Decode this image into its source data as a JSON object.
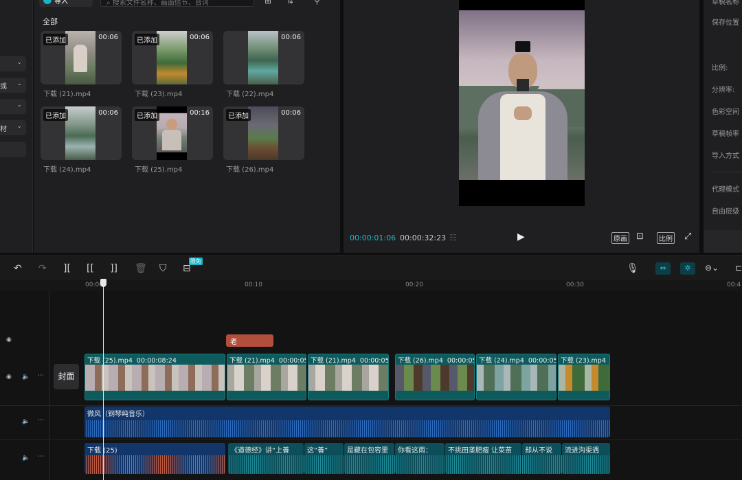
{
  "media": {
    "import_label": "导入",
    "search_placeholder": "搜索文件名称、画面信节、台词",
    "section": "全部",
    "clips": [
      {
        "name": "下载 (21).mp4",
        "duration": "00:06",
        "badge": "已添加"
      },
      {
        "name": "下载 (23).mp4",
        "duration": "00:06",
        "badge": "已添加"
      },
      {
        "name": "下载 (22).mp4",
        "duration": "00:06",
        "badge": ""
      },
      {
        "name": "下载 (24).mp4",
        "duration": "00:06",
        "badge": "已添加"
      },
      {
        "name": "下载 (25).mp4",
        "duration": "00:16",
        "badge": "已添加"
      },
      {
        "name": "下载 (26).mp4",
        "duration": "00:06",
        "badge": "已添加"
      }
    ]
  },
  "left_strip": {
    "items": [
      "",
      "或",
      "",
      "材"
    ]
  },
  "preview": {
    "current_time": "00:00:01:06",
    "total_time": "00:00:32:23",
    "original_label": "原画",
    "ratio_label": "比例"
  },
  "props": {
    "labels": [
      "草稿名称",
      "保存位置",
      "比例:",
      "分辨率:",
      "色彩空间",
      "草稿帧率",
      "导入方式",
      "代理模式",
      "自由层级"
    ]
  },
  "toolbar": {
    "badge": "限免"
  },
  "ruler": {
    "ticks": [
      "00:00",
      "00:10",
      "00:20",
      "00:30",
      "00:4"
    ]
  },
  "timeline": {
    "cover_label": "封面",
    "text_clip": "老",
    "video_clips": [
      {
        "name": "下载 (25).mp4",
        "duration": "00:00:08:24"
      },
      {
        "name": "下载 (21).mp4",
        "duration": "00:00:05"
      },
      {
        "name": "下载 (21).mp4",
        "duration": "00:00:05"
      },
      {
        "name": "下载 (26).mp4",
        "duration": "00:00:05"
      },
      {
        "name": "下载 (24).mp4",
        "duration": "00:00:05"
      },
      {
        "name": "下载 (23).mp4",
        "duration": ""
      }
    ],
    "music_label": "微风（钢琴纯音乐）",
    "voice_label": "下载 (25)",
    "captions": [
      "《道德经》讲“上善",
      "这“善”",
      "是藏在包容里",
      "你看这雨：",
      "不挑田垄肥瘦 让菜苗",
      "却从不说",
      "流进沟渠遇"
    ]
  }
}
